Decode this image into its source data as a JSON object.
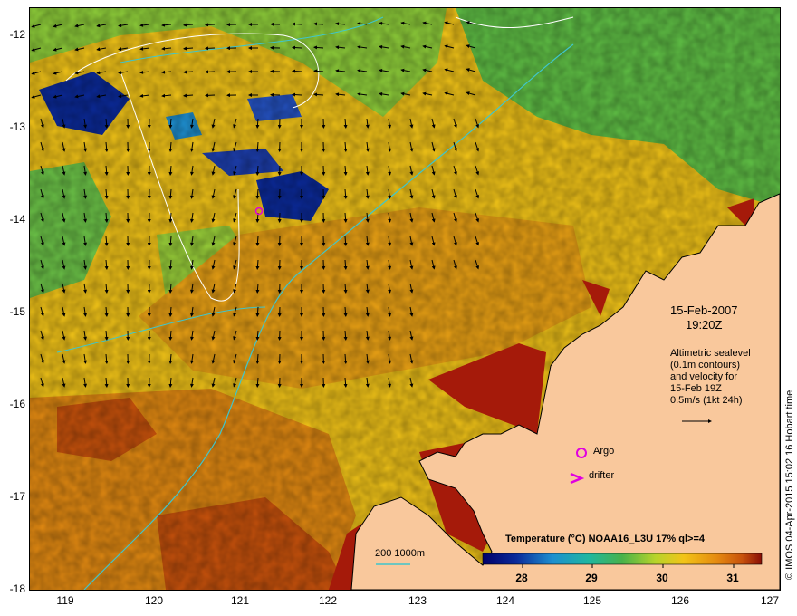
{
  "map": {
    "date": "15-Feb-2007",
    "time": "19:20Z",
    "altimetry_lines": [
      "Altimetric sealevel",
      "(0.1m contours)",
      "and velocity for",
      "15-Feb 19Z",
      "0.5m/s (1kt 24h)"
    ],
    "legend_argo": "Argo",
    "legend_drifter": "drifter",
    "isobath_label": "200  1000m",
    "colorbar_title": "Temperature (°C) NOAA16_L3U 17% ql>=4",
    "colorbar_ticks": [
      "28",
      "29",
      "30",
      "31"
    ],
    "credit": "© IMOS 04-Apr-2015 15:02:16 Hobart time",
    "lat_ticks": [
      "-12",
      "-13",
      "-14",
      "-15",
      "-16",
      "-17",
      "-18"
    ],
    "lon_ticks": [
      "119",
      "120",
      "121",
      "122",
      "123",
      "124",
      "125",
      "126",
      "127"
    ],
    "colors": {
      "land": "#f9c89c",
      "warm_red": "#a51a0a",
      "orange": "#e58a10",
      "yellow": "#f2c418",
      "green": "#49b24a",
      "blue": "#0b2a9a",
      "isobath": "#3fc6cc",
      "argo": "#e000e0"
    }
  }
}
